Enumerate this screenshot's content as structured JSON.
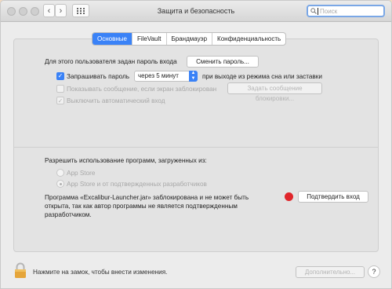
{
  "window": {
    "title": "Защита и безопасность",
    "search_placeholder": "Поиск"
  },
  "tabs": [
    "Основные",
    "FileVault",
    "Брандмауэр",
    "Конфиденциальность"
  ],
  "general": {
    "password_set_label": "Для этого пользователя задан пароль входа",
    "change_password_button": "Сменить пароль...",
    "require_password_label": "Запрашивать пароль",
    "require_password_value": "через 5 минут",
    "require_password_suffix": "при выходе из режима сна или заставки",
    "show_message_label": "Показывать сообщение, если экран заблокирован",
    "set_message_button": "Задать сообщение блокировки...",
    "disable_autologin_label": "Выключить автоматический вход"
  },
  "downloads": {
    "heading": "Разрешить использование программ, загруженных из:",
    "option_app_store": "App Store",
    "option_app_store_identified": "App Store и от подтвержденных разработчиков",
    "blocked_message": "Программа «Excalibur-Launcher.jar» заблокирована и не может быть открыта, так как автор программы не является подтвержденным разработчиком.",
    "open_anyway_button": "Подтвердить вход"
  },
  "footer": {
    "lock_text": "Нажмите на замок, чтобы внести изменения.",
    "advanced_button": "Дополнительно...",
    "help_button": "?"
  },
  "colors": {
    "accent": "#3a82f7",
    "alert_dot": "#e0262b"
  }
}
